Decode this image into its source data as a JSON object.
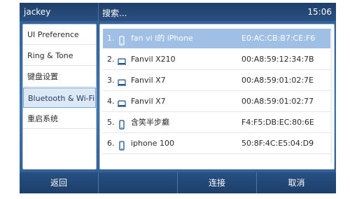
{
  "status": {
    "user": "jackey",
    "search_placeholder": "搜索...",
    "time": "15:06"
  },
  "left_menu": [
    {
      "label": "UI Preference",
      "selected": false
    },
    {
      "label": "Ring & Tone",
      "selected": false
    },
    {
      "label": "键盘设置",
      "selected": false
    },
    {
      "label": "Bluetooth & Wi-Fi",
      "selected": true
    },
    {
      "label": "重启系统",
      "selected": false
    },
    {
      "label": "",
      "selected": false
    }
  ],
  "devices": [
    {
      "index": "1.",
      "icon": "phone-icon",
      "name": "fan vi l的 iPhone",
      "mac": "E0:AC:CB:B7:CE:F6",
      "selected": true
    },
    {
      "index": "2.",
      "icon": "laptop-icon",
      "name": "Fanvil X210",
      "mac": "00:A8:59:12:34:7B",
      "selected": false
    },
    {
      "index": "3.",
      "icon": "laptop-icon",
      "name": "Fanvil X7",
      "mac": "00:A8:59:01:02:7E",
      "selected": false
    },
    {
      "index": "4.",
      "icon": "laptop-icon",
      "name": "Fanvil X7",
      "mac": "00:A8:59:01:02:77",
      "selected": false
    },
    {
      "index": "5.",
      "icon": "phone-icon",
      "name": "含笑半步癫",
      "mac": "F4:F5:DB:EC:80:6E",
      "selected": false
    },
    {
      "index": "6.",
      "icon": "phone-icon",
      "name": "iphone 100",
      "mac": "50:8F:4C:E5:04:D9",
      "selected": false
    }
  ],
  "softkeys": [
    "返回",
    "",
    "连接",
    "取消"
  ],
  "colors": {
    "accent": "#2f5e96",
    "selected_row": "#9fc0e4"
  }
}
